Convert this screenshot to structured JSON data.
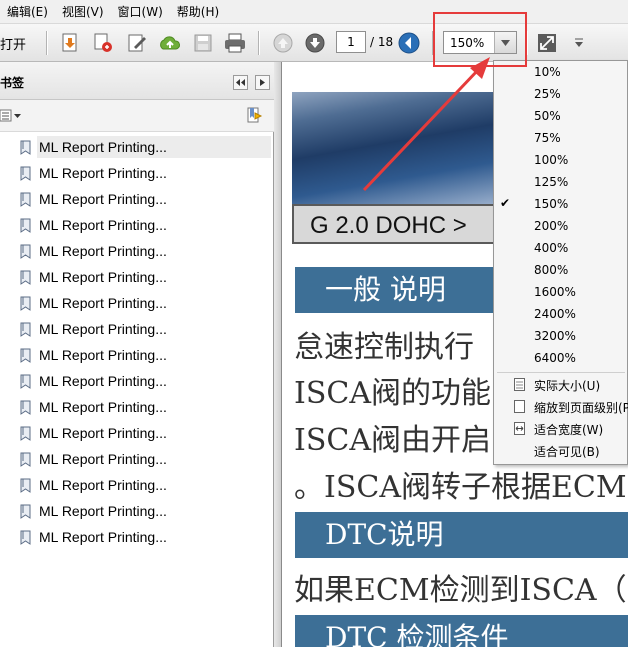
{
  "menubar": {
    "items": [
      "编辑(E)",
      "视图(V)",
      "窗口(W)",
      "帮助(H)"
    ]
  },
  "toolbar": {
    "open_label": "打开",
    "current_page": "1",
    "total_pages": "/ 18",
    "zoom_value": "150%"
  },
  "bookmarks": {
    "title": "书签",
    "items": [
      "ML Report Printing...",
      "ML Report Printing...",
      "ML Report Printing...",
      "ML Report Printing...",
      "ML Report Printing...",
      "ML Report Printing...",
      "ML Report Printing...",
      "ML Report Printing...",
      "ML Report Printing...",
      "ML Report Printing...",
      "ML Report Printing...",
      "ML Report Printing...",
      "ML Report Printing...",
      "ML Report Printing...",
      "ML Report Printing...",
      "ML Report Printing..."
    ]
  },
  "zoom_menu": {
    "levels": [
      "10%",
      "25%",
      "50%",
      "75%",
      "100%",
      "125%",
      "150%",
      "200%",
      "400%",
      "800%",
      "1600%",
      "2400%",
      "3200%",
      "6400%"
    ],
    "checked": "150%",
    "fit_options": [
      "实际大小(U)",
      "缩放到页面级别(P)",
      "适合宽度(W)",
      "适合可见(B)"
    ]
  },
  "document": {
    "banner_text": "G 2.0 DOHC >",
    "heading_1": "一般 说明",
    "line_1": "怠速控制执行",
    "line_2": "ISCA阀的功能",
    "line_3": "ISCA阀由开启",
    "line_4": "。ISCA阀转子根据ECM",
    "heading_2": "DTC说明",
    "line_5": "如果ECM检测到ISCA（",
    "heading_3": "DTC 检测条件"
  },
  "colors": {
    "highlight_box": "#e53b3b",
    "section_header": "#3d6f96"
  }
}
